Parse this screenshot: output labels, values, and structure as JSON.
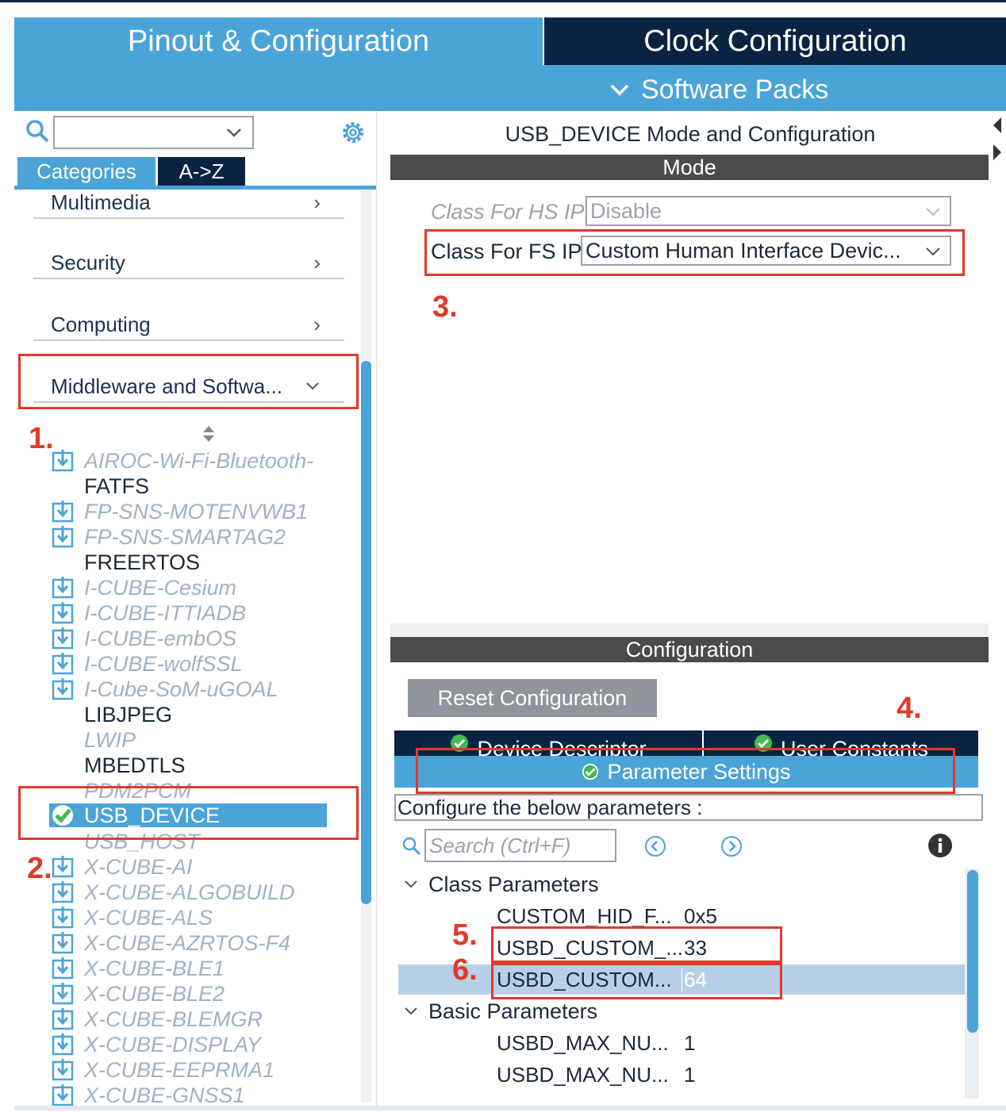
{
  "tabs": {
    "pinout": "Pinout & Configuration",
    "clock": "Clock Configuration",
    "software_packs": "Software Packs"
  },
  "left": {
    "category_tab": "Categories",
    "az_tab": "A->Z",
    "categories": [
      {
        "label": "Multimedia"
      },
      {
        "label": "Security"
      },
      {
        "label": "Computing"
      },
      {
        "label": "Middleware and Softwa..."
      }
    ],
    "items": [
      {
        "label": "AIROC-Wi-Fi-Bluetooth-",
        "state": "pack"
      },
      {
        "label": "FATFS",
        "state": "enabled"
      },
      {
        "label": "FP-SNS-MOTENVWB1",
        "state": "pack"
      },
      {
        "label": "FP-SNS-SMARTAG2",
        "state": "pack"
      },
      {
        "label": "FREERTOS",
        "state": "enabled"
      },
      {
        "label": "I-CUBE-Cesium",
        "state": "pack"
      },
      {
        "label": "I-CUBE-ITTIADB",
        "state": "pack"
      },
      {
        "label": "I-CUBE-embOS",
        "state": "pack"
      },
      {
        "label": "I-CUBE-wolfSSL",
        "state": "pack"
      },
      {
        "label": "I-Cube-SoM-uGOAL",
        "state": "pack"
      },
      {
        "label": "LIBJPEG",
        "state": "enabled"
      },
      {
        "label": "LWIP",
        "state": "disabled"
      },
      {
        "label": "MBEDTLS",
        "state": "enabled"
      },
      {
        "label": "PDM2PCM",
        "state": "disabled"
      },
      {
        "label": "USB_DEVICE",
        "state": "selected"
      },
      {
        "label": "USB_HOST",
        "state": "disabled"
      },
      {
        "label": "X-CUBE-AI",
        "state": "pack"
      },
      {
        "label": "X-CUBE-ALGOBUILD",
        "state": "pack"
      },
      {
        "label": "X-CUBE-ALS",
        "state": "pack"
      },
      {
        "label": "X-CUBE-AZRTOS-F4",
        "state": "pack"
      },
      {
        "label": "X-CUBE-BLE1",
        "state": "pack"
      },
      {
        "label": "X-CUBE-BLE2",
        "state": "pack"
      },
      {
        "label": "X-CUBE-BLEMGR",
        "state": "pack"
      },
      {
        "label": "X-CUBE-DISPLAY",
        "state": "pack"
      },
      {
        "label": "X-CUBE-EEPRMA1",
        "state": "pack"
      },
      {
        "label": "X-CUBE-GNSS1",
        "state": "pack"
      }
    ]
  },
  "right": {
    "title": "USB_DEVICE Mode and Configuration",
    "mode_header": "Mode",
    "hs_label": "Class For HS IP",
    "hs_value": "Disable",
    "fs_label": "Class For FS IP",
    "fs_value": "Custom Human Interface Devic...",
    "config_header": "Configuration",
    "reset_button": "Reset Configuration",
    "tab_device_descriptor": "Device Descriptor",
    "tab_user_constants": "User Constants",
    "tab_parameter_settings": "Parameter Settings",
    "configure_text": "Configure the below parameters :",
    "search_placeholder": "Search (Ctrl+F)",
    "class_group": "Class Parameters",
    "basic_group": "Basic Parameters",
    "class_params": [
      {
        "name": "CUSTOM_HID_F...",
        "value": "0x5"
      },
      {
        "name": "USBD_CUSTOM_...",
        "value": "33"
      },
      {
        "name": "USBD_CUSTOM...",
        "value": "64"
      }
    ],
    "basic_params": [
      {
        "name": "USBD_MAX_NU...",
        "value": "1"
      },
      {
        "name": "USBD_MAX_NU...",
        "value": "1"
      }
    ]
  },
  "annotations": {
    "step1": "1.",
    "step2": "2.",
    "step3": "3.",
    "step4": "4.",
    "step5": "5.",
    "step6": "6."
  },
  "colors": {
    "accent_blue": "#4aa4d8",
    "navy": "#0b2342",
    "annotation_red": "#e03a2a",
    "header_grey": "#4b4b4b"
  }
}
